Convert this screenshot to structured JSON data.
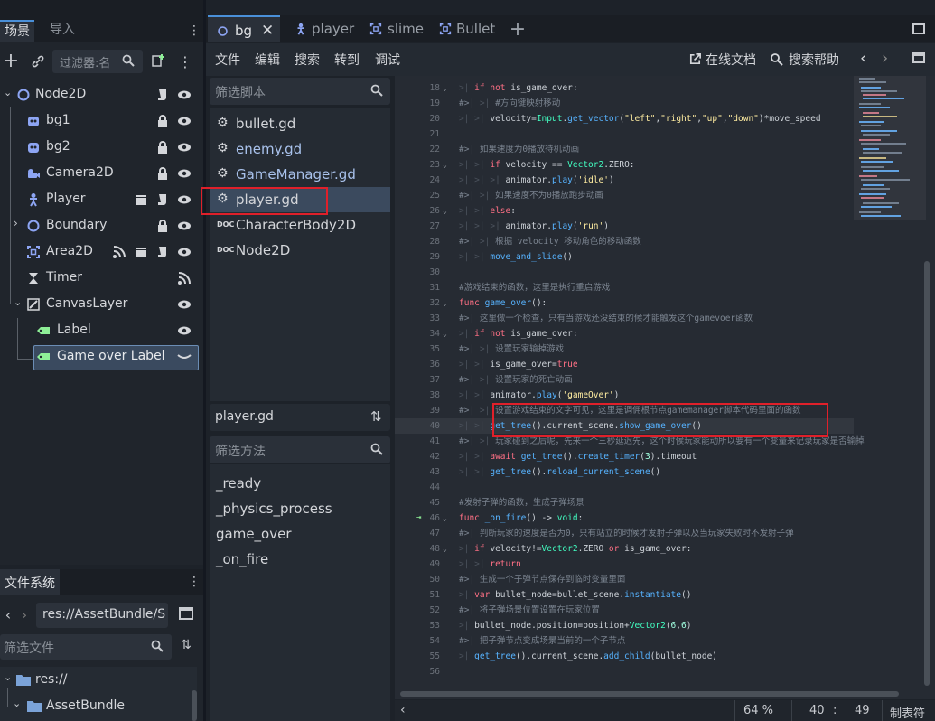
{
  "scene_dock": {
    "tabs": [
      "场景",
      "导入"
    ],
    "filter_placeholder": "过滤器:名",
    "tree": [
      {
        "label": "Node2D"
      },
      {
        "label": "bg1"
      },
      {
        "label": "bg2"
      },
      {
        "label": "Camera2D"
      },
      {
        "label": "Player"
      },
      {
        "label": "Boundary"
      },
      {
        "label": "Area2D"
      },
      {
        "label": "Timer"
      },
      {
        "label": "CanvasLayer"
      },
      {
        "label": "Label"
      },
      {
        "label": "Game over Label"
      }
    ]
  },
  "filesystem": {
    "title": "文件系统",
    "path": "res://AssetBundle/S",
    "filter_placeholder": "筛选文件",
    "items": [
      {
        "label": "res://"
      },
      {
        "label": "AssetBundle"
      }
    ]
  },
  "tabs": [
    {
      "label": "bg",
      "active": true
    },
    {
      "label": "player"
    },
    {
      "label": "slime"
    },
    {
      "label": "Bullet"
    }
  ],
  "menu": {
    "items": [
      "文件",
      "编辑",
      "搜索",
      "转到",
      "调试"
    ],
    "online_docs": "在线文档",
    "search_help": "搜索帮助"
  },
  "script_panel": {
    "filter_placeholder": "筛选脚本",
    "scripts": [
      {
        "name": "bullet.gd"
      },
      {
        "name": "enemy.gd"
      },
      {
        "name": "GameManager.gd"
      },
      {
        "name": "player.gd"
      },
      {
        "name": "CharacterBody2D"
      },
      {
        "name": "Node2D"
      }
    ],
    "current_script": "player.gd",
    "method_filter_placeholder": "筛选方法",
    "methods": [
      "_ready",
      "_physics_process",
      "game_over",
      "_on_fire"
    ]
  },
  "code": {
    "lines": [
      {
        "n": "18",
        "text": "if not is_game_over:"
      },
      {
        "n": "19",
        "text": "#方向键映射移动"
      },
      {
        "n": "20",
        "text": "velocity=Input.get_vector(\"left\",\"right\",\"up\",\"down\")*move_speed"
      },
      {
        "n": "21",
        "text": ""
      },
      {
        "n": "22",
        "text": "如果速度为0播放待机动画"
      },
      {
        "n": "23",
        "text": "if velocity == Vector2.ZERO:"
      },
      {
        "n": "24",
        "text": "animator.play('idle')"
      },
      {
        "n": "25",
        "text": "如果速度不为0播放跑步动画"
      },
      {
        "n": "26",
        "text": "else:"
      },
      {
        "n": "27",
        "text": "animator.play('run')"
      },
      {
        "n": "28",
        "text": "根据 velocity 移动角色的移动函数"
      },
      {
        "n": "29",
        "text": "move_and_slide()"
      },
      {
        "n": "30",
        "text": ""
      },
      {
        "n": "31",
        "text": "#游戏结束的函数，这里是执行重启游戏"
      },
      {
        "n": "32",
        "text": "func game_over():"
      },
      {
        "n": "33",
        "text": "这里做一个检查，只有当游戏还没结束的候才能触发这个gamevoer函数"
      },
      {
        "n": "34",
        "text": "if not is_game_over:"
      },
      {
        "n": "35",
        "text": "设置玩家输掉游戏"
      },
      {
        "n": "36",
        "text": "is_game_over=true"
      },
      {
        "n": "37",
        "text": "设置玩家的死亡动画"
      },
      {
        "n": "38",
        "text": "animator.play('gameOver')"
      },
      {
        "n": "39",
        "text": "设置游戏结束的文字可见，这里是调佣根节点gamemanager脚本代码里面的函数"
      },
      {
        "n": "40",
        "text": "get_tree().current_scene.show_game_over()"
      },
      {
        "n": "41",
        "text": "玩家碰到之后呢，先来一个三秒延迟先，这个时候玩家能动所以要有一个变量来记录玩家是否输掉"
      },
      {
        "n": "42",
        "text": "await get_tree().create_timer(3).timeout"
      },
      {
        "n": "43",
        "text": "get_tree().reload_current_scene()"
      },
      {
        "n": "44",
        "text": ""
      },
      {
        "n": "45",
        "text": "#发射子弹的函数，生成子弹场景"
      },
      {
        "n": "46",
        "text": "func _on_fire() -> void:"
      },
      {
        "n": "47",
        "text": "判断玩家的速度是否为0，只有站立的时候才发射子弹以及当玩家失败时不发射子弹"
      },
      {
        "n": "48",
        "text": "if velocity!=Vector2.ZERO or is_game_over:"
      },
      {
        "n": "49",
        "text": "return"
      },
      {
        "n": "50",
        "text": "生成一个子弹节点保存到临时变量里面"
      },
      {
        "n": "51",
        "text": "var bullet_node=bullet_scene.instantiate()"
      },
      {
        "n": "52",
        "text": "将子弹场景位置设置在玩家位置"
      },
      {
        "n": "53",
        "text": "bullet_node.position=position+Vector2(6,6)"
      },
      {
        "n": "54",
        "text": "把子弹节点变成场景当前的一个子节点"
      },
      {
        "n": "55",
        "text": "get_tree().current_scene.add_child(bullet_node)"
      },
      {
        "n": "56",
        "text": ""
      }
    ]
  },
  "status": {
    "zoom": "64 %",
    "line": "40",
    "sep": ":",
    "col": "49",
    "indent": "制表符"
  },
  "colors": {
    "accent": "#4a90d9",
    "highlight_box": "#e0202a"
  }
}
